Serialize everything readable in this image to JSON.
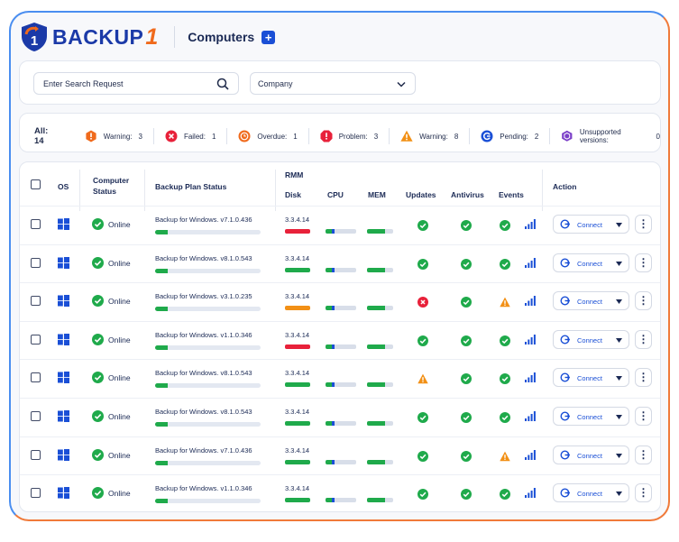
{
  "app": {
    "logo_text": "BACKUP",
    "logo_number": "1",
    "page_title": "Computers",
    "add_label": "+"
  },
  "search": {
    "placeholder": "Enter Search Request"
  },
  "company": {
    "label": "Company"
  },
  "summary": {
    "all_label": "All: 14",
    "items": [
      {
        "icon": "hexagon-warning-icon",
        "label": "Warning:",
        "count": "3",
        "color": "#f06a1c"
      },
      {
        "icon": "failed-x-icon",
        "label": "Failed:",
        "count": "1",
        "color": "#e8213a"
      },
      {
        "icon": "overdue-clock-icon",
        "label": "Overdue:",
        "count": "1",
        "color": "#f06a1c"
      },
      {
        "icon": "problem-octagon-icon",
        "label": "Problem:",
        "count": "3",
        "color": "#e8213a"
      },
      {
        "icon": "triangle-warning-icon",
        "label": "Warning:",
        "count": "8",
        "color": "#f29016"
      },
      {
        "icon": "pending-icon",
        "label": "Pending:",
        "count": "2",
        "color": "#1a4fd6"
      },
      {
        "icon": "unsupported-cube-icon",
        "label": "Unsupported versions:",
        "count": "0",
        "color": "#7b3fc8"
      }
    ]
  },
  "table": {
    "headers": {
      "os": "OS",
      "computer_status": "Computer Status",
      "backup_plan_status": "Backup Plan Status",
      "rmm": "RMM",
      "disk": "Disk",
      "cpu": "CPU",
      "mem": "MEM",
      "updates": "Updates",
      "antivirus": "Antivirus",
      "events": "Events",
      "action": "Action"
    },
    "rows": [
      {
        "status": "Online",
        "plan": "Backup for Windows. v7.1.0.436",
        "version": "3.3.4.14",
        "disk_color": "#e8213a",
        "updates": "ok",
        "antivirus": "ok",
        "events": "ok",
        "action": "Connect"
      },
      {
        "status": "Online",
        "plan": "Backup for Windows. v8.1.0.543",
        "version": "3.3.4.14",
        "disk_color": "#1faa4b",
        "updates": "ok",
        "antivirus": "ok",
        "events": "ok",
        "action": "Connect"
      },
      {
        "status": "Online",
        "plan": "Backup for Windows. v3.1.0.235",
        "version": "3.3.4.14",
        "disk_color": "#f29016",
        "updates": "error",
        "antivirus": "ok",
        "events": "warning",
        "action": "Connect"
      },
      {
        "status": "Online",
        "plan": "Backup for Windows. v1.1.0.346",
        "version": "3.3.4.14",
        "disk_color": "#e8213a",
        "updates": "ok",
        "antivirus": "ok",
        "events": "ok",
        "action": "Connect"
      },
      {
        "status": "Online",
        "plan": "Backup for Windows. v8.1.0.543",
        "version": "3.3.4.14",
        "disk_color": "#1faa4b",
        "updates": "warning",
        "antivirus": "ok",
        "events": "ok",
        "action": "Connect"
      },
      {
        "status": "Online",
        "plan": "Backup for Windows. v8.1.0.543",
        "version": "3.3.4.14",
        "disk_color": "#1faa4b",
        "updates": "ok",
        "antivirus": "ok",
        "events": "ok",
        "action": "Connect"
      },
      {
        "status": "Online",
        "plan": "Backup for Windows. v7.1.0.436",
        "version": "3.3.4.14",
        "disk_color": "#1faa4b",
        "updates": "ok",
        "antivirus": "ok",
        "events": "warning",
        "action": "Connect"
      },
      {
        "status": "Online",
        "plan": "Backup for Windows. v1.1.0.346",
        "version": "3.3.4.14",
        "disk_color": "#1faa4b",
        "updates": "ok",
        "antivirus": "ok",
        "events": "ok",
        "action": "Connect"
      }
    ]
  },
  "colors": {
    "accent": "#1a4fd6",
    "ok": "#1faa4b",
    "warn": "#f29016",
    "error": "#e8213a"
  }
}
